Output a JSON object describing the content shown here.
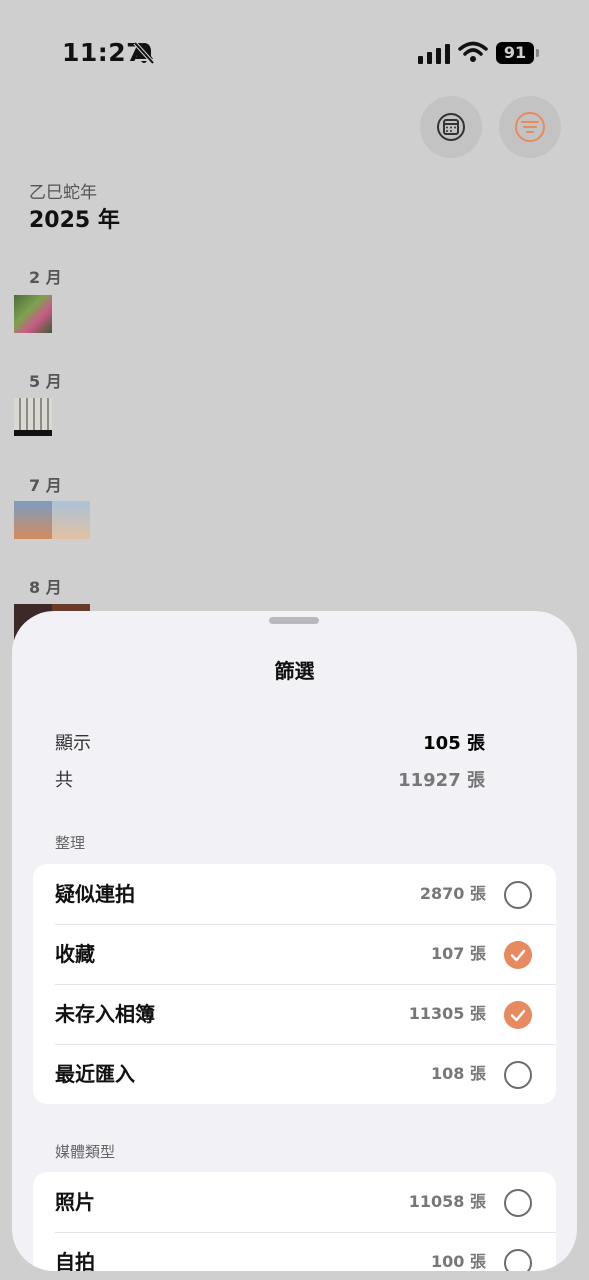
{
  "status_bar": {
    "time": "11:27",
    "battery": "91"
  },
  "toolbar": {
    "calendar_icon": "calendar-icon",
    "filter_icon": "filter-lines-icon",
    "accent": "#e88a5f"
  },
  "timeline": {
    "lunar_year": "乙巳蛇年",
    "year": "2025 年",
    "months": [
      "2 月",
      "5 月",
      "7 月",
      "8 月"
    ]
  },
  "sheet": {
    "title": "篩選",
    "summary": {
      "shown_label": "顯示",
      "shown_value": "105 張",
      "total_label": "共",
      "total_value": "11927 張"
    },
    "organize": {
      "label": "整理",
      "items": [
        {
          "label": "疑似連拍",
          "count": "2870 張",
          "checked": false
        },
        {
          "label": "收藏",
          "count": "107 張",
          "checked": true
        },
        {
          "label": "未存入相簿",
          "count": "11305 張",
          "checked": true
        },
        {
          "label": "最近匯入",
          "count": "108 張",
          "checked": false
        }
      ]
    },
    "media": {
      "label": "媒體類型",
      "items": [
        {
          "label": "照片",
          "count": "11058 張",
          "checked": false
        },
        {
          "label": "自拍",
          "count": "100 張",
          "checked": false
        }
      ]
    }
  }
}
